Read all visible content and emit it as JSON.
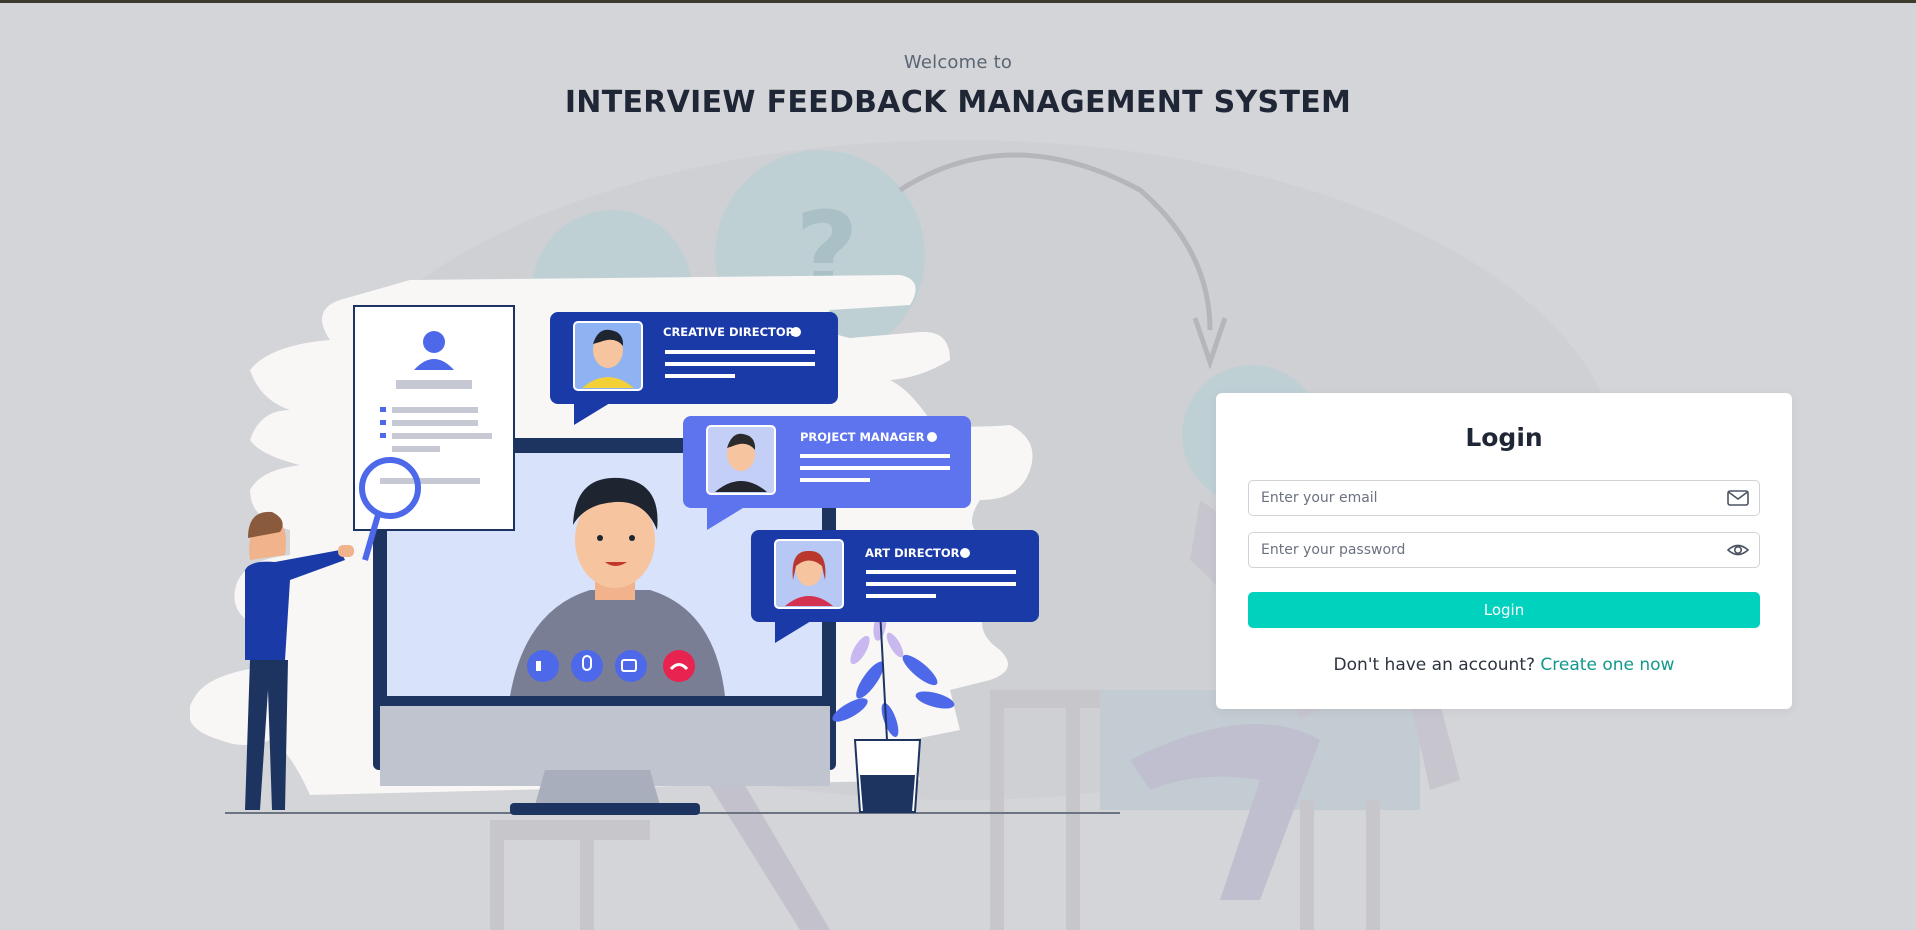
{
  "header": {
    "welcome": "Welcome to",
    "title": "INTERVIEW FEEDBACK MANAGEMENT SYSTEM"
  },
  "illustration": {
    "bubbles": [
      {
        "role": "CREATIVE DIRECTOR"
      },
      {
        "role": "PROJECT MANAGER"
      },
      {
        "role": "ART DIRECTOR"
      }
    ]
  },
  "login": {
    "title": "Login",
    "email_placeholder": "Enter your email",
    "password_placeholder": "Enter your password",
    "button_label": "Login",
    "signup_prompt": "Don't have an account?",
    "signup_link": "Create one now"
  },
  "colors": {
    "accent": "#00d2bd",
    "link": "#11988c",
    "background": "#d4d5d8",
    "bubble_dark": "#1a3aa8",
    "bubble_light": "#5d74ee"
  },
  "icons": {
    "email_field": "envelope-icon",
    "password_field": "eye-icon"
  }
}
